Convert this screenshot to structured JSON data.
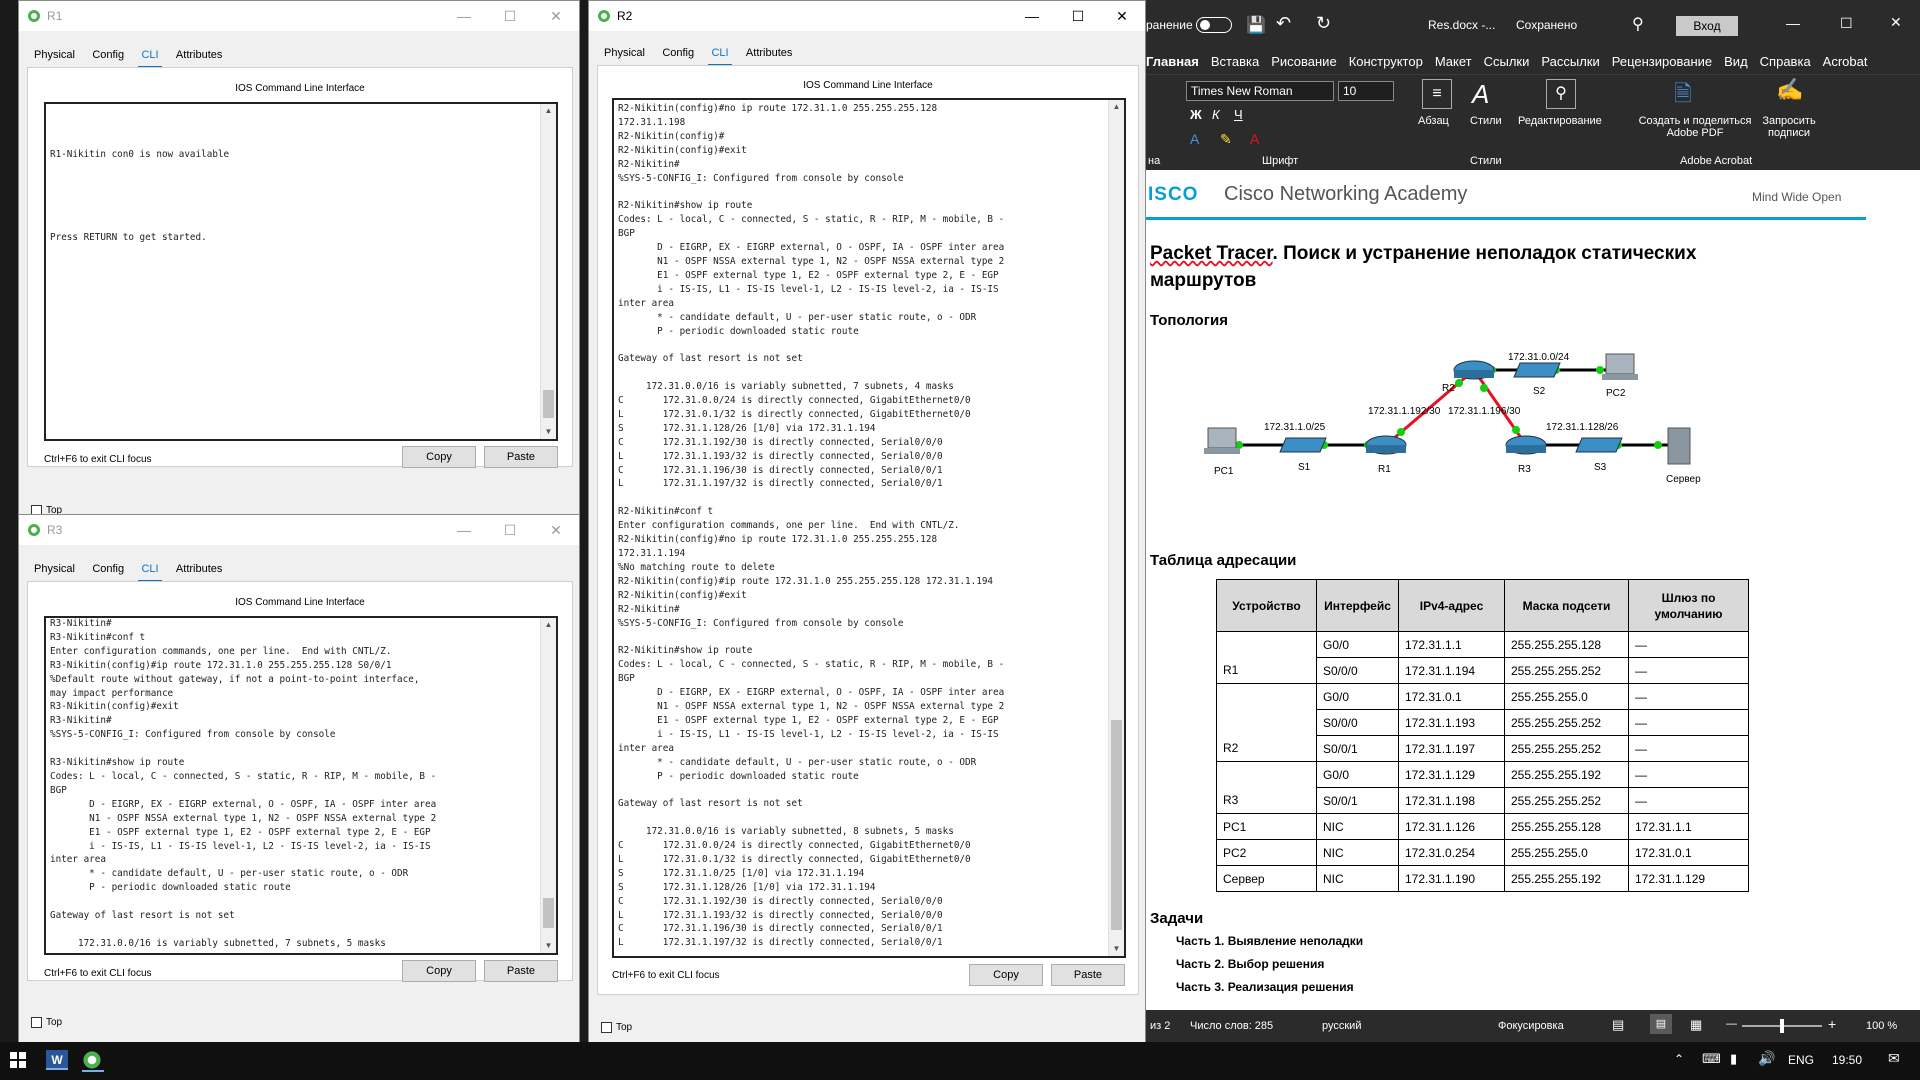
{
  "r1": {
    "title": "R1",
    "tabs": [
      "Physical",
      "Config",
      "CLI",
      "Attributes"
    ],
    "cli_header": "IOS Command Line Interface",
    "console": "\n\n\nR1-Nikitin con0 is now available\n\n\n\n\n\nPress RETURN to get started.",
    "hint": "Ctrl+F6 to exit CLI focus",
    "copy": "Copy",
    "paste": "Paste",
    "top": "Top"
  },
  "r3": {
    "title": "R3",
    "tabs": [
      "Physical",
      "Config",
      "CLI",
      "Attributes"
    ],
    "cli_header": "IOS Command Line Interface",
    "console": "R3-Nikitin#\nR3-Nikitin#conf t\nEnter configuration commands, one per line.  End with CNTL/Z.\nR3-Nikitin(config)#ip route 172.31.1.0 255.255.255.128 S0/0/1\n%Default route without gateway, if not a point-to-point interface,\nmay impact performance\nR3-Nikitin(config)#exit\nR3-Nikitin#\n%SYS-5-CONFIG_I: Configured from console by console\n\nR3-Nikitin#show ip route\nCodes: L - local, C - connected, S - static, R - RIP, M - mobile, B -\nBGP\n       D - EIGRP, EX - EIGRP external, O - OSPF, IA - OSPF inter area\n       N1 - OSPF NSSA external type 1, N2 - OSPF NSSA external type 2\n       E1 - OSPF external type 1, E2 - OSPF external type 2, E - EGP\n       i - IS-IS, L1 - IS-IS level-1, L2 - IS-IS level-2, ia - IS-IS\ninter area\n       * - candidate default, U - per-user static route, o - ODR\n       P - periodic downloaded static route\n\nGateway of last resort is not set\n\n     172.31.0.0/16 is variably subnetted, 7 subnets, 5 masks",
    "hint": "Ctrl+F6 to exit CLI focus",
    "copy": "Copy",
    "paste": "Paste",
    "top": "Top"
  },
  "r2": {
    "title": "R2",
    "tabs": [
      "Physical",
      "Config",
      "CLI",
      "Attributes"
    ],
    "cli_header": "IOS Command Line Interface",
    "console": "R2-Nikitin(config)#no ip route 172.31.1.0 255.255.255.128\n172.31.1.198\nR2-Nikitin(config)#\nR2-Nikitin(config)#exit\nR2-Nikitin#\n%SYS-5-CONFIG_I: Configured from console by console\n\nR2-Nikitin#show ip route\nCodes: L - local, C - connected, S - static, R - RIP, M - mobile, B -\nBGP\n       D - EIGRP, EX - EIGRP external, O - OSPF, IA - OSPF inter area\n       N1 - OSPF NSSA external type 1, N2 - OSPF NSSA external type 2\n       E1 - OSPF external type 1, E2 - OSPF external type 2, E - EGP\n       i - IS-IS, L1 - IS-IS level-1, L2 - IS-IS level-2, ia - IS-IS\ninter area\n       * - candidate default, U - per-user static route, o - ODR\n       P - periodic downloaded static route\n\nGateway of last resort is not set\n\n     172.31.0.0/16 is variably subnetted, 7 subnets, 4 masks\nC       172.31.0.0/24 is directly connected, GigabitEthernet0/0\nL       172.31.0.1/32 is directly connected, GigabitEthernet0/0\nS       172.31.1.128/26 [1/0] via 172.31.1.194\nC       172.31.1.192/30 is directly connected, Serial0/0/0\nL       172.31.1.193/32 is directly connected, Serial0/0/0\nC       172.31.1.196/30 is directly connected, Serial0/0/1\nL       172.31.1.197/32 is directly connected, Serial0/0/1\n\nR2-Nikitin#conf t\nEnter configuration commands, one per line.  End with CNTL/Z.\nR2-Nikitin(config)#no ip route 172.31.1.0 255.255.255.128\n172.31.1.194\n%No matching route to delete\nR2-Nikitin(config)#ip route 172.31.1.0 255.255.255.128 172.31.1.194\nR2-Nikitin(config)#exit\nR2-Nikitin#\n%SYS-5-CONFIG_I: Configured from console by console\n\nR2-Nikitin#show ip route\nCodes: L - local, C - connected, S - static, R - RIP, M - mobile, B -\nBGP\n       D - EIGRP, EX - EIGRP external, O - OSPF, IA - OSPF inter area\n       N1 - OSPF NSSA external type 1, N2 - OSPF NSSA external type 2\n       E1 - OSPF external type 1, E2 - OSPF external type 2, E - EGP\n       i - IS-IS, L1 - IS-IS level-1, L2 - IS-IS level-2, ia - IS-IS\ninter area\n       * - candidate default, U - per-user static route, o - ODR\n       P - periodic downloaded static route\n\nGateway of last resort is not set\n\n     172.31.0.0/16 is variably subnetted, 8 subnets, 5 masks\nC       172.31.0.0/24 is directly connected, GigabitEthernet0/0\nL       172.31.0.1/32 is directly connected, GigabitEthernet0/0\nS       172.31.1.0/25 [1/0] via 172.31.1.194\nS       172.31.1.128/26 [1/0] via 172.31.1.194\nC       172.31.1.192/30 is directly connected, Serial0/0/0\nL       172.31.1.193/32 is directly connected, Serial0/0/0\nC       172.31.1.196/30 is directly connected, Serial0/0/1\nL       172.31.1.197/32 is directly connected, Serial0/0/1",
    "hint": "Ctrl+F6 to exit CLI focus",
    "copy": "Copy",
    "paste": "Paste",
    "top": "Top"
  },
  "word": {
    "qat": {
      "autosave": "ранение",
      "filename": "Res.docx -...",
      "saved": "Сохранено",
      "login": "Вход"
    },
    "tabs": [
      "Главная",
      "Вставка",
      "Рисование",
      "Конструктор",
      "Макет",
      "Ссылки",
      "Рассылки",
      "Рецензирование",
      "Вид",
      "Справка",
      "Acrobat"
    ],
    "ribbon": {
      "font_name": "Times New Roman",
      "font_size": "10",
      "bold": "Ж",
      "italic": "К",
      "underline": "Ч",
      "paragraph": "Абзац",
      "styles": "Стили",
      "editing": "Редактирование",
      "create_pdf": "Создать и поделиться Adobe PDF",
      "request_sign": "Запросить подписи",
      "grp_font": "Шрифт",
      "grp_styles": "Стили",
      "grp_acrobat": "Adobe Acrobat",
      "grp_left": "на"
    },
    "doc": {
      "brand": "Cisco Networking Academy",
      "brand_prefix": "ISCO",
      "tagline": "Mind Wide Open",
      "title_link": "Packet Tracer",
      "title_rest": ". Поиск и устранение неполадок статических маршрутов",
      "h_topology": "Топология",
      "topo": {
        "net_r2_s2": "172.31.0.0/24",
        "net_r1_r2": "172.31.1.192/30",
        "net_r2_r3": "172.31.1.196/30",
        "net_pc1_r1": "172.31.1.0/25",
        "net_r3_srv": "172.31.1.128/26",
        "r1": "R1",
        "r2": "R2",
        "r3": "R3",
        "s1": "S1",
        "s2": "S2",
        "s3": "S3",
        "pc1": "PC1",
        "pc2": "PC2",
        "server": "Сервер"
      },
      "h_table": "Таблица адресации",
      "table_headers": [
        "Устройство",
        "Интерфейс",
        "IPv4-адрес",
        "Маска подсети",
        "Шлюз по умолчанию"
      ],
      "table_rows": [
        [
          "",
          "G0/0",
          "172.31.1.1",
          "255.255.255.128",
          "—"
        ],
        [
          "R1",
          "S0/0/0",
          "172.31.1.194",
          "255.255.255.252",
          "—"
        ],
        [
          "",
          "G0/0",
          "172.31.0.1",
          "255.255.255.0",
          "—"
        ],
        [
          "",
          "S0/0/0",
          "172.31.1.193",
          "255.255.255.252",
          "—"
        ],
        [
          "R2",
          "S0/0/1",
          "172.31.1.197",
          "255.255.255.252",
          "—"
        ],
        [
          "",
          "G0/0",
          "172.31.1.129",
          "255.255.255.192",
          "—"
        ],
        [
          "R3",
          "S0/0/1",
          "172.31.1.198",
          "255.255.255.252",
          "—"
        ],
        [
          "PC1",
          "NIC",
          "172.31.1.126",
          "255.255.255.128",
          "172.31.1.1"
        ],
        [
          "PC2",
          "NIC",
          "172.31.0.254",
          "255.255.255.0",
          "172.31.0.1"
        ],
        [
          "Сервер",
          "NIC",
          "172.31.1.190",
          "255.255.255.192",
          "172.31.1.129"
        ]
      ],
      "h_tasks": "Задачи",
      "tasks": [
        "Часть 1. Выявление неполадки",
        "Часть 2. Выбор решения",
        "Часть 3. Реализация решения"
      ]
    },
    "status": {
      "page": "из 2",
      "words": "Число слов: 285",
      "lang": "русский",
      "focus": "Фокусировка",
      "zoom": "100 %"
    }
  },
  "taskbar": {
    "lang": "ENG",
    "time": "19:50"
  },
  "colors": {
    "cisco_blue": "#049fd9",
    "tab_blue": "#0a78c8",
    "link_red": "#e81123"
  }
}
